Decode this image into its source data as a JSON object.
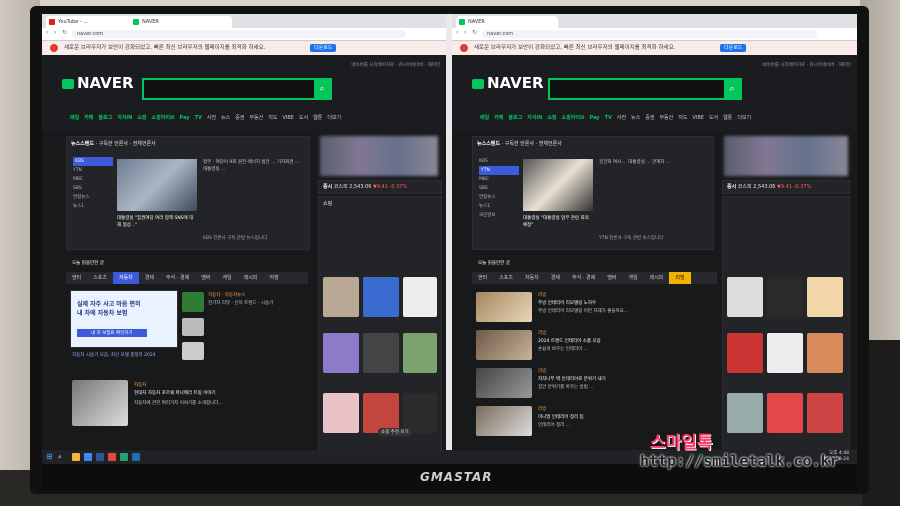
{
  "colors": {
    "naver_green": "#03c75a",
    "accent_blue": "#3b5bdb",
    "warning_red": "#e53935",
    "accent_yellow": "#f0b400"
  },
  "monitor": {
    "brand": "GMASTAR"
  },
  "watermark": {
    "line1": "스마일톡",
    "line2": "http://smiletalk.co.kr"
  },
  "left_window": {
    "tab1": "YouTube - ...",
    "tab2": "NAVER",
    "url": "naver.com",
    "warning": "새로운 브라우저가 보안이 강화되었고, 빠른 최신 브라우저의 웹페이지를 최적화 하세요.",
    "warning_button": "다운로드",
    "logo": "NAVER",
    "menu": [
      "메일",
      "카페",
      "블로그",
      "지식iN",
      "쇼핑",
      "쇼핑라이브",
      "Pay",
      "TV",
      "사전",
      "뉴스",
      "증권",
      "부동산",
      "지도",
      "VIBE",
      "도서",
      "웹툰",
      "더보기"
    ],
    "newsstand_title": "뉴스스탠드",
    "newsstand_sub": "구독한 언론사 · 전체언론사",
    "news_sources": [
      "KBS",
      "YTN",
      "MBC",
      "SBS",
      "연합뉴스",
      "뉴스1"
    ],
    "news_headline": "대통령실 \"집권여당 여러 정책 SNS에 대해 협상...\"",
    "news_body": "정부 · 여당이 9회 원전·에너지 법안 ... 기자회견 ... 대통령실 ...",
    "news_caption": "KBS 언론사 구독 관련 뉴스입니다",
    "stock_label": "증시",
    "stock_value": "코스피 2,543.06",
    "stock_change": "▼9.41 -0.37%",
    "shopping_title": "쇼핑",
    "today_tabs": [
      "엔터",
      "스포츠",
      "자동차",
      "경제",
      "주식 · 경제",
      "멤버",
      "게임",
      "레시피",
      "여행"
    ],
    "today_header": "오늘 읽을만한 글",
    "ad_title": "실제 자주 사고 마음 편히",
    "ad_sub": "내 차에 자동차 보험",
    "ad_button": "내 차 보험료 확인하기",
    "article_title": "자동차 시승기 모음, 최신 모델 총정리 2024",
    "recommend_label": "자동차 · 자동차뉴스",
    "recommend_title": "전기차 리뷰 · 신차 트렌드 · 시승기",
    "bottom_label": "자동차",
    "bottom_title": "현대차 자동차 포르쉐 파나메라 트림 이야기",
    "bottom_body": "자동차에 관한 여러가지 이야기를 소개합니다...",
    "float_btn": "쇼핑 추천 보기"
  },
  "right_window": {
    "tab1": "NAVER",
    "url": "naver.com",
    "warning": "새로운 브라우저가 보안이 강화되었고, 빠른 최신 브라우저의 웹페이지를 최적화 하세요.",
    "warning_button": "다운로드",
    "logo": "NAVER",
    "menu": [
      "메일",
      "카페",
      "블로그",
      "지식iN",
      "쇼핑",
      "쇼핑라이브",
      "Pay",
      "TV",
      "사전",
      "뉴스",
      "증권",
      "부동산",
      "지도",
      "VIBE",
      "도서",
      "웹툰",
      "더보기"
    ],
    "newsstand_title": "뉴스스탠드",
    "newsstand_sub": "구독한 언론사 · 전체언론사",
    "news_sources": [
      "KBS",
      "YTN",
      "MBC",
      "SBS",
      "연합뉴스",
      "뉴스1",
      "국민일보"
    ],
    "news_headline": "대통령실 \"대통령실 업무 관련 회의 예정\"",
    "news_body": "김건희 여사 ... 대통령실 ... 관계자 ...",
    "news_caption": "YTN 언론사 구독 관련 뉴스입니다",
    "stock_label": "증시",
    "stock_value": "코스피 2,543.06",
    "stock_change": "▼9.41 -0.37%",
    "today_tabs": [
      "엔터",
      "스포츠",
      "자동차",
      "경제",
      "주식 · 경제",
      "멤버",
      "게임",
      "레시피",
      "리빙"
    ],
    "today_header": "오늘 읽을만한 글",
    "article1_label": "리빙",
    "article1_title": "주방 인테리어 리모델링 노하우",
    "article1_body": "주방 인테리어 리모델링 어떤 자재가 좋을까요...",
    "article2_label": "리빙",
    "article2_title": "2024 트렌드 인테리어 소품 모음",
    "article2_body": "손쉽게 바꾸는 인테리어 ...",
    "article3_label": "리빙",
    "article3_title": "자작나무 벽 인테리어로 분위기 내기",
    "article3_body": "집안 분위기를 바꾸는 방법 ...",
    "article4_label": "리빙",
    "article4_title": "미니멀 인테리어 정리 팁",
    "article4_body": "인테리어 정리 ..."
  },
  "taskbar": {
    "time": "오후 4:48",
    "date": "2024-08-24"
  }
}
